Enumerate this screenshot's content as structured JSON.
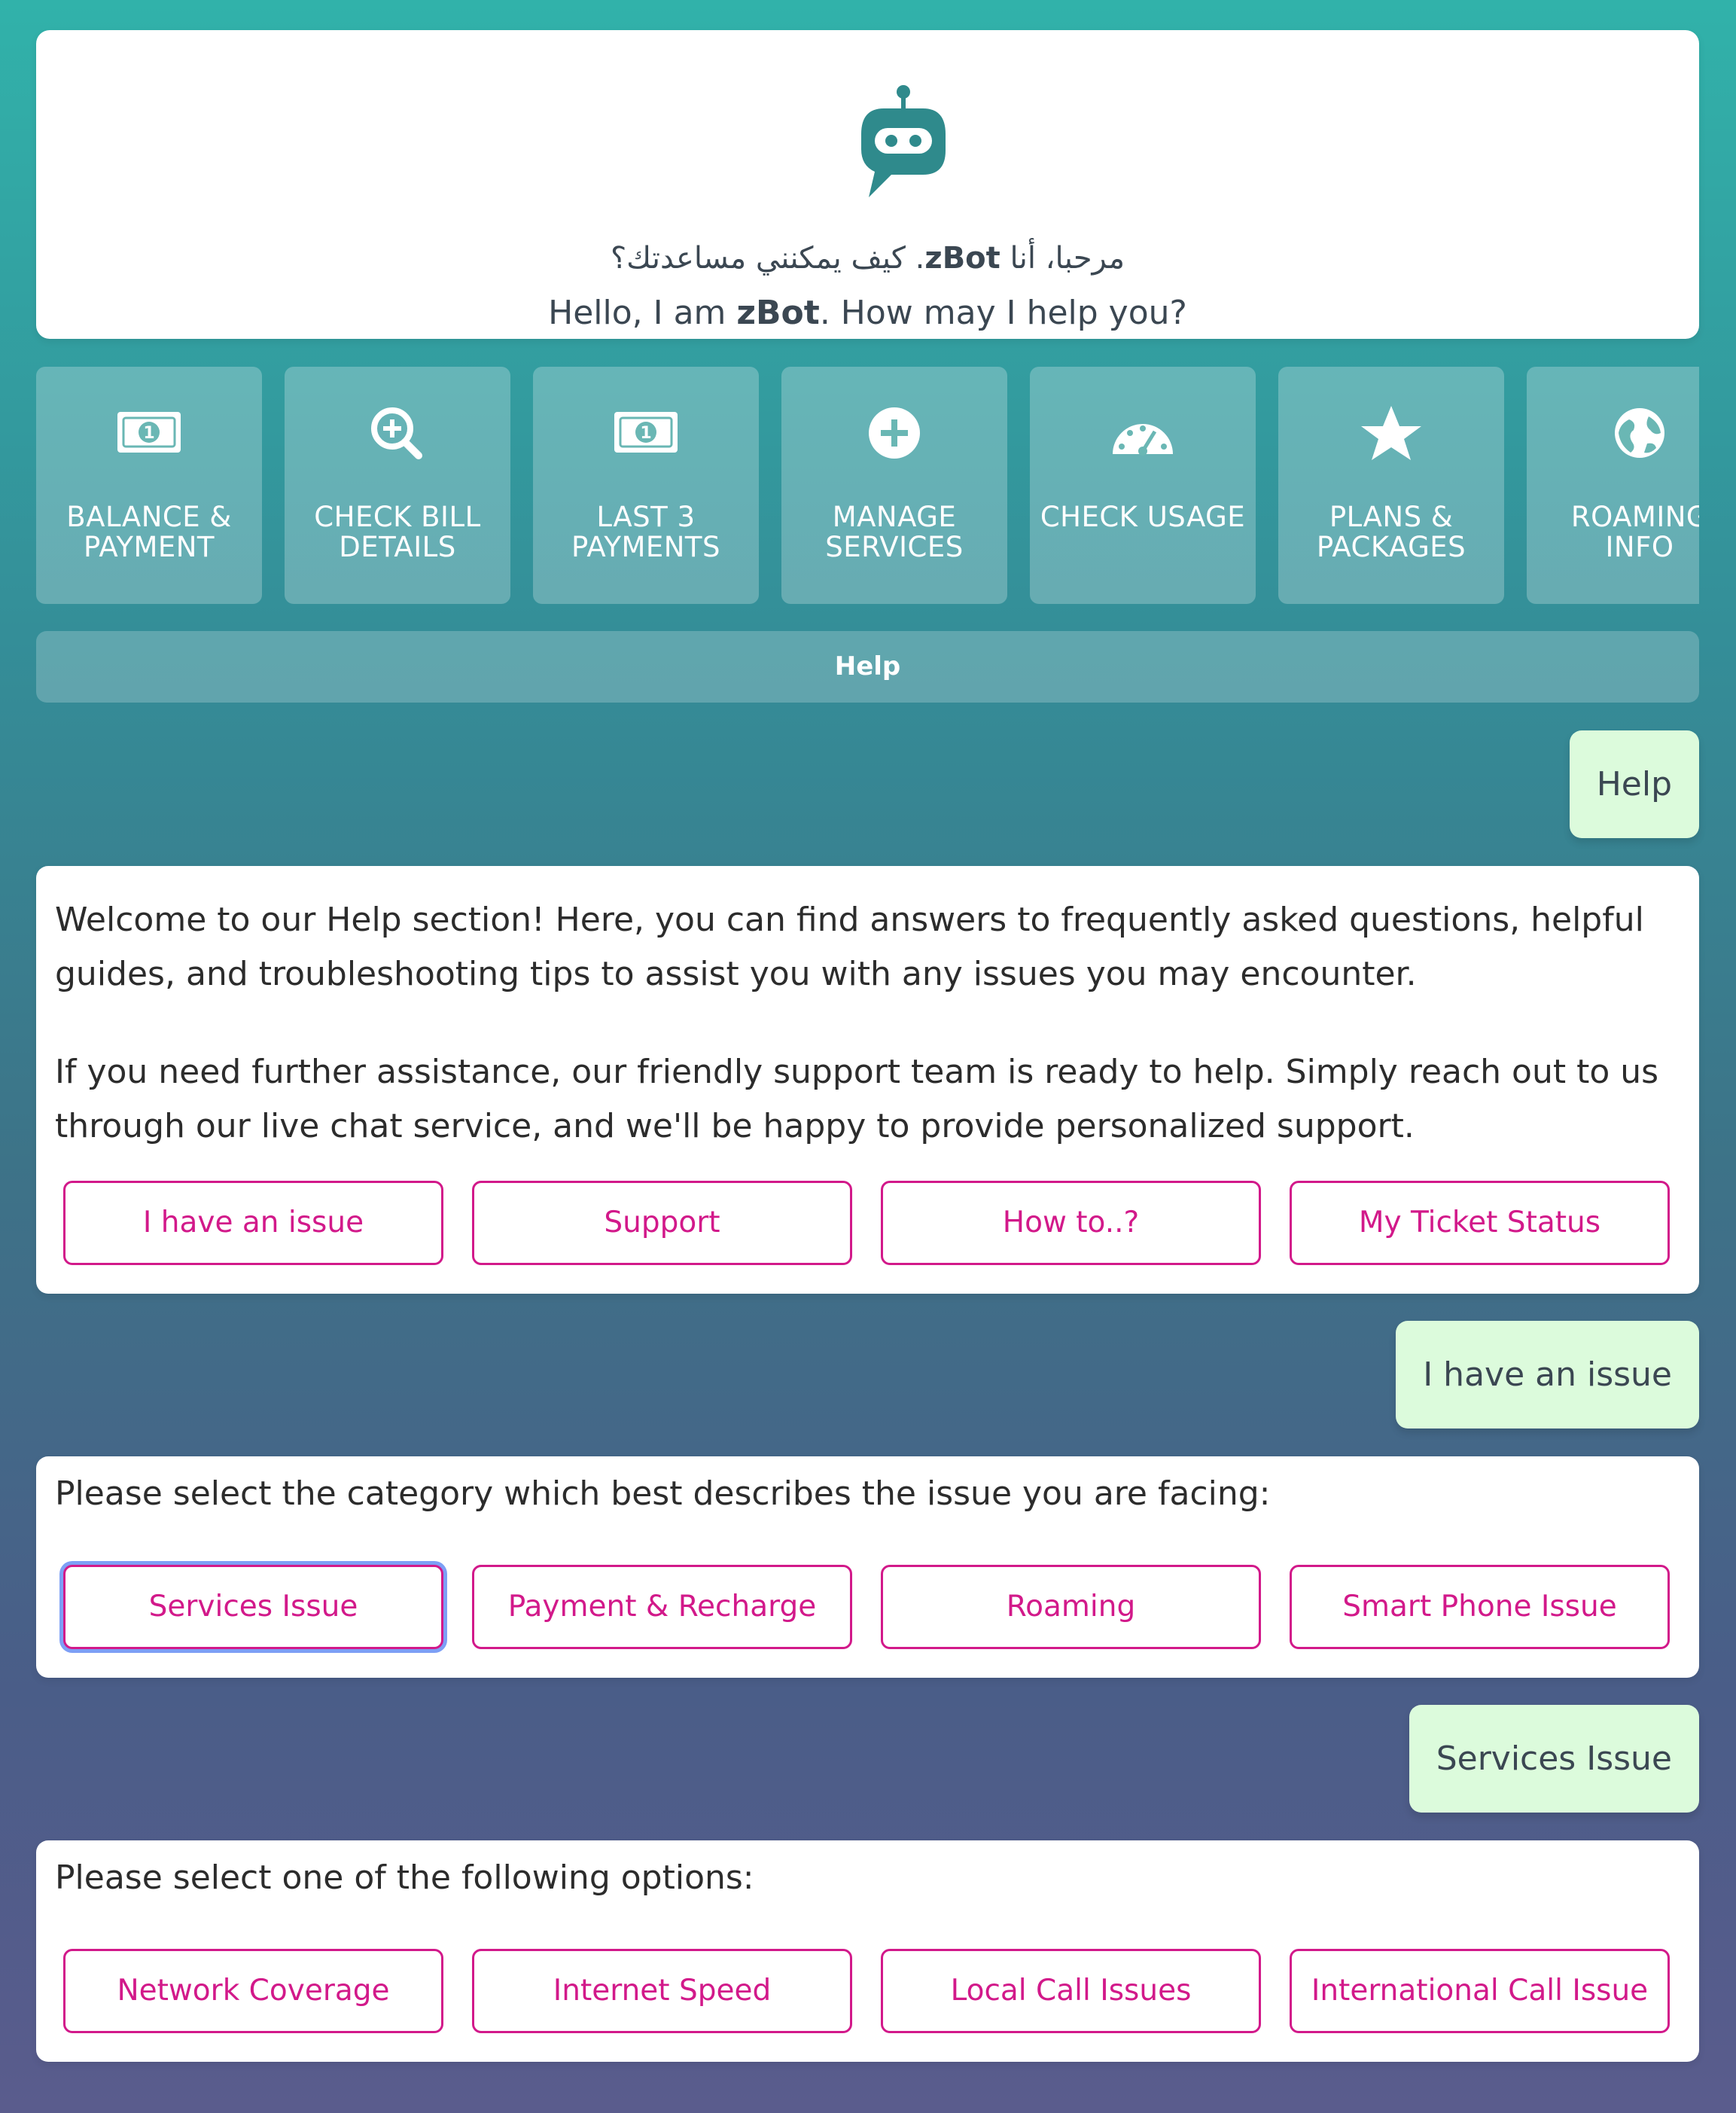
{
  "header": {
    "greeting_ar_pre": "مرحبا، أنا",
    "greeting_ar_brand": "zBot",
    "greeting_ar_post": ". كيف يمكنني مساعدتك؟",
    "greeting_en_pre": "Hello, I am ",
    "greeting_en_brand": "zBot",
    "greeting_en_post": ". How may I help you?",
    "logo_icon": "robot-chat-icon"
  },
  "menu": {
    "items": [
      {
        "label": "BALANCE & PAYMENT",
        "icon": "money-bill-icon"
      },
      {
        "label": "CHECK BILL DETAILS",
        "icon": "search-plus-icon"
      },
      {
        "label": "LAST 3 PAYMENTS",
        "icon": "money-bill-icon"
      },
      {
        "label": "MANAGE SERVICES",
        "icon": "plus-circle-icon"
      },
      {
        "label": "CHECK USAGE",
        "icon": "gauge-icon"
      },
      {
        "label": "PLANS & PACKAGES",
        "icon": "star-icon"
      },
      {
        "label": "ROAMING INFO",
        "icon": "globe-icon"
      }
    ]
  },
  "help_bar": {
    "label": "Help"
  },
  "conversation": {
    "user_1": "Help",
    "bot_1": {
      "para_1": "Welcome to our Help section! Here, you can find answers to frequently asked questions, helpful guides, and troubleshooting tips to assist you with any issues you may encounter.",
      "para_2": "If you need further assistance, our friendly support team is ready to help. Simply reach out to us through our live chat service, and we'll be happy to provide personalized support.",
      "options": [
        "I have an issue",
        "Support",
        "How to..?",
        "My Ticket Status"
      ]
    },
    "user_2": "I have an issue",
    "bot_2": {
      "text": "Please select the category which best describes the issue you are facing:",
      "options": [
        "Services Issue",
        "Payment & Recharge",
        "Roaming",
        "Smart Phone Issue"
      ]
    },
    "user_3": "Services Issue",
    "bot_3": {
      "text": "Please select one of the following options:",
      "options": [
        "Network Coverage",
        "Internet Speed",
        "Local Call Issues",
        "International Call Issue"
      ]
    }
  },
  "colors": {
    "accent": "#d2198a",
    "user_bubble": "#dcfbdc",
    "logo": "#2f8a8c"
  }
}
